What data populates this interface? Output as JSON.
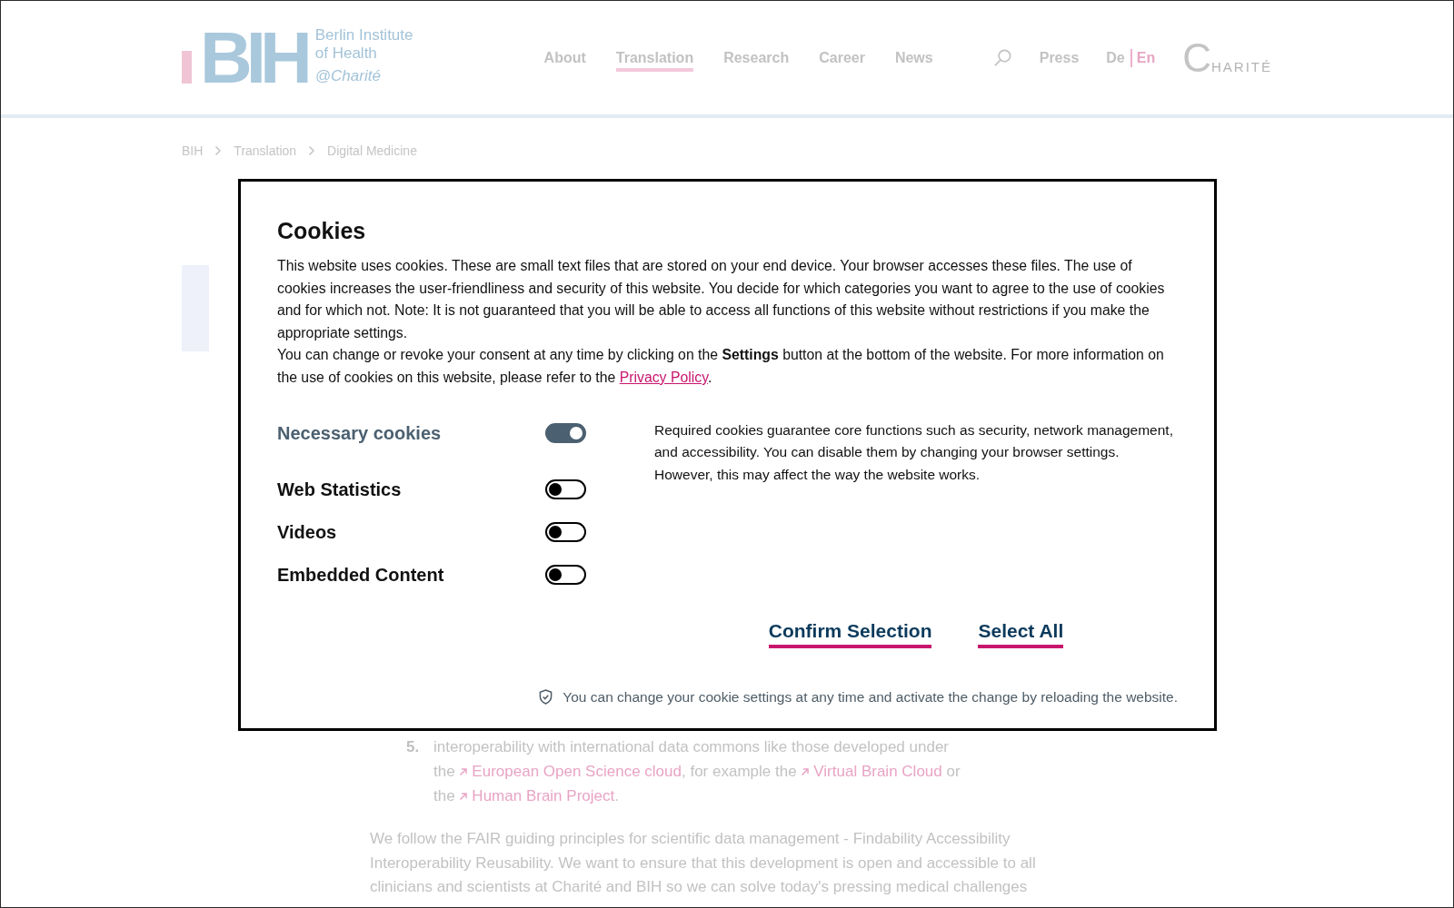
{
  "header": {
    "logo": {
      "letters": "BIH",
      "name_lines": [
        "Berlin Institute",
        "of Health"
      ],
      "tagline": "@Charité"
    },
    "nav": [
      {
        "label": "About",
        "selected": false
      },
      {
        "label": "Translation",
        "selected": true
      },
      {
        "label": "Research",
        "selected": false
      },
      {
        "label": "Career",
        "selected": false
      },
      {
        "label": "News",
        "selected": false
      }
    ],
    "press": "Press",
    "languages": [
      {
        "label": "De",
        "selected": false
      },
      {
        "label": "En",
        "selected": true
      }
    ],
    "partner_logo": "CHARITÉ"
  },
  "breadcrumb": [
    "BIH",
    "Translation",
    "Digital Medicine"
  ],
  "page": {
    "list_item": {
      "number": "5.",
      "parts": [
        {
          "kind": "text",
          "text": "interoperability with international data commons like those developed under the "
        },
        {
          "kind": "link",
          "text": "European Open Science cloud"
        },
        {
          "kind": "text",
          "text": ", for example the "
        },
        {
          "kind": "link",
          "text": "Virtual Brain Cloud"
        },
        {
          "kind": "text",
          "text": " or the "
        },
        {
          "kind": "link",
          "text": "Human Brain Project"
        },
        {
          "kind": "text",
          "text": "."
        }
      ]
    },
    "paragraph": "We follow the FAIR guiding principles for scientific data management - Findability Accessibility Interoperability Reusability. We want to ensure that this development is open and accessible to all clinicians and scientists at Charité and BIH so we can solve today's pressing medical challenges"
  },
  "cookie_dialog": {
    "title": "Cookies",
    "intro": "This website uses cookies. These are small text files that are stored on your end device. Your browser accesses these files. The use of cookies increases the user-friendliness and security of this website. You decide for which categories you want to agree to the use of cookies and for which not. Note: It is not guaranteed that you will be able to access all functions of this website without restrictions if you make the appropriate settings.",
    "consent": {
      "before": "You can change or revoke your consent at any time by clicking on the **Settings** button at the bottom of the website. For more information on the use of cookies on this website, please refer to the ",
      "link": "Privacy Policy",
      "after": "."
    },
    "categories": [
      {
        "label": "Necessary cookies",
        "checked": true,
        "disabled": true
      },
      {
        "label": "Web Statistics",
        "checked": false,
        "disabled": false
      },
      {
        "label": "Videos",
        "checked": false,
        "disabled": false
      },
      {
        "label": "Embedded Content",
        "checked": false,
        "disabled": false
      }
    ],
    "description": "Required cookies guarantee core functions such as security, network management, and accessibility. You can disable them by changing your browser settings. However, this may affect the way the website works.",
    "buttons": [
      "Confirm Selection",
      "Select All"
    ],
    "note": "You can change your cookie settings at any time and activate the change by reloading the website."
  }
}
